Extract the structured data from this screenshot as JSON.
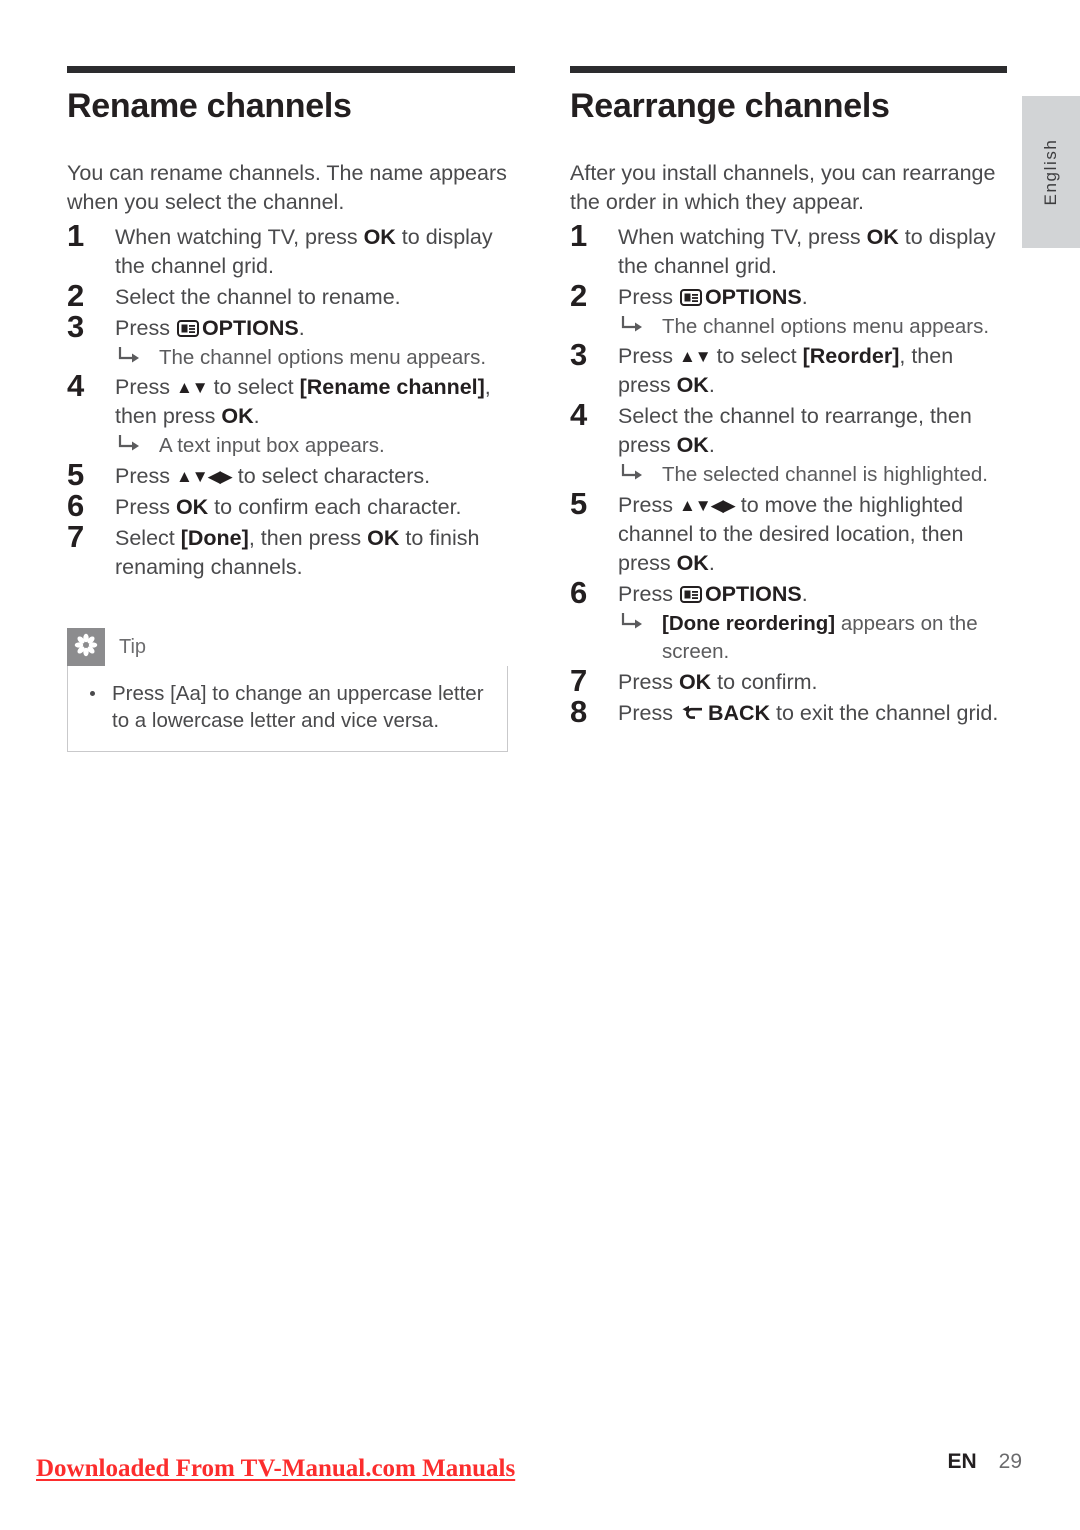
{
  "page": {
    "language_tab": "English",
    "footer_link": "Downloaded From TV-Manual.com Manuals",
    "footer_lang_code": "EN",
    "footer_page_number": "29",
    "rule_color": "#2c2c2e",
    "link_color": "#fc2d2d",
    "tab_bg_color": "#d2d4d6",
    "tip_icon_bg_color": "#8c8c8e"
  },
  "left_column": {
    "title": "Rename channels",
    "intro": "You can rename channels. The name appears when you select the channel.",
    "steps": [
      {
        "num": "1",
        "text_before": "When watching TV, press ",
        "bold1": "OK",
        "text_after": " to display the channel grid.",
        "result": ""
      },
      {
        "num": "2",
        "text_before": "Select the channel to rename.",
        "bold1": "",
        "text_after": "",
        "result": ""
      },
      {
        "num": "3",
        "text_before": "Press ",
        "icon": "options-icon",
        "bold1": "OPTIONS",
        "text_after": ".",
        "result": "The channel options menu appears."
      },
      {
        "num": "4",
        "text_before": "Press ",
        "arrows": "▲▼",
        "mid": " to select ",
        "bold1": "[Rename channel]",
        "text_after": ", then press ",
        "bold2": "OK",
        "text_end": ".",
        "result": "A text input box appears."
      },
      {
        "num": "5",
        "text_before": "Press ",
        "arrows": "▲▼◀▶",
        "mid": " to select characters.",
        "result": ""
      },
      {
        "num": "6",
        "text_before": "Press ",
        "bold1": "OK",
        "text_after": " to confirm each character.",
        "result": ""
      },
      {
        "num": "7",
        "text_before": "Select ",
        "bold1": "[Done]",
        "text_after": ", then press ",
        "bold2": "OK",
        "text_end": " to finish renaming channels.",
        "result": ""
      }
    ],
    "tip": {
      "title": "Tip",
      "icon": "asterisk-flower-icon",
      "item_before": "Press ",
      "item_bold": "[Aa]",
      "item_after": " to change an uppercase letter to a lowercase letter and vice versa."
    }
  },
  "right_column": {
    "title": "Rearrange channels",
    "intro": "After you install channels, you can rearrange the order in which they appear.",
    "steps": [
      {
        "num": "1",
        "text_before": "When watching TV, press ",
        "bold1": "OK",
        "text_after": " to display the channel grid.",
        "result": ""
      },
      {
        "num": "2",
        "text_before": "Press ",
        "icon": "options-icon",
        "bold1": "OPTIONS",
        "text_after": ".",
        "result": "The channel options menu appears."
      },
      {
        "num": "3",
        "text_before": "Press ",
        "arrows": "▲▼",
        "mid": " to select ",
        "bold1": "[Reorder]",
        "text_after": ", then press ",
        "bold2": "OK",
        "text_end": ".",
        "result": ""
      },
      {
        "num": "4",
        "text_before": "Select the channel to rearrange, then press ",
        "bold1": "OK",
        "text_after": ".",
        "result": "The selected channel is highlighted."
      },
      {
        "num": "5",
        "text_before": "Press ",
        "arrows": "▲▼◀▶",
        "mid": " to move the highlighted channel to the desired location, then press ",
        "bold1": "OK",
        "text_after": ".",
        "result": ""
      },
      {
        "num": "6",
        "text_before": "Press ",
        "icon": "options-icon",
        "bold1": "OPTIONS",
        "text_after": ".",
        "result_bold": "[Done reordering]",
        "result_after": " appears on the screen."
      },
      {
        "num": "7",
        "text_before": "Press ",
        "bold1": "OK",
        "text_after": " to confirm.",
        "result": ""
      },
      {
        "num": "8",
        "text_before": "Press ",
        "icon": "back-icon",
        "bold1": "BACK",
        "text_after": " to exit the channel grid.",
        "result": ""
      }
    ]
  }
}
